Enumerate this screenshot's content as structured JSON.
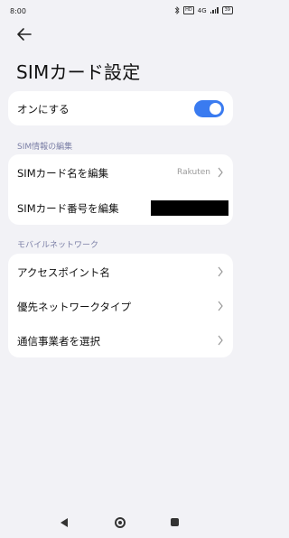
{
  "status_bar": {
    "time": "8:00",
    "network": "4G",
    "sim_badge": "HD",
    "battery": "39"
  },
  "header": {
    "title": "SIMカード設定"
  },
  "toggle_row": {
    "label": "オンにする",
    "enabled": true,
    "accent": "#3a7bf0"
  },
  "sim_info_section": {
    "heading": "SIM情報の編集",
    "items": [
      {
        "label": "SIMカード名を編集",
        "value": "Rakuten"
      },
      {
        "label": "SIMカード番号を編集",
        "value": ""
      }
    ]
  },
  "mobile_network_section": {
    "heading": "モバイルネットワーク",
    "items": [
      {
        "label": "アクセスポイント名"
      },
      {
        "label": "優先ネットワークタイプ"
      },
      {
        "label": "通信事業者を選択"
      }
    ]
  },
  "icons": {
    "back": "arrow-left-icon",
    "chevron": "chevron-right-icon",
    "bluetooth": "bluetooth-icon"
  }
}
